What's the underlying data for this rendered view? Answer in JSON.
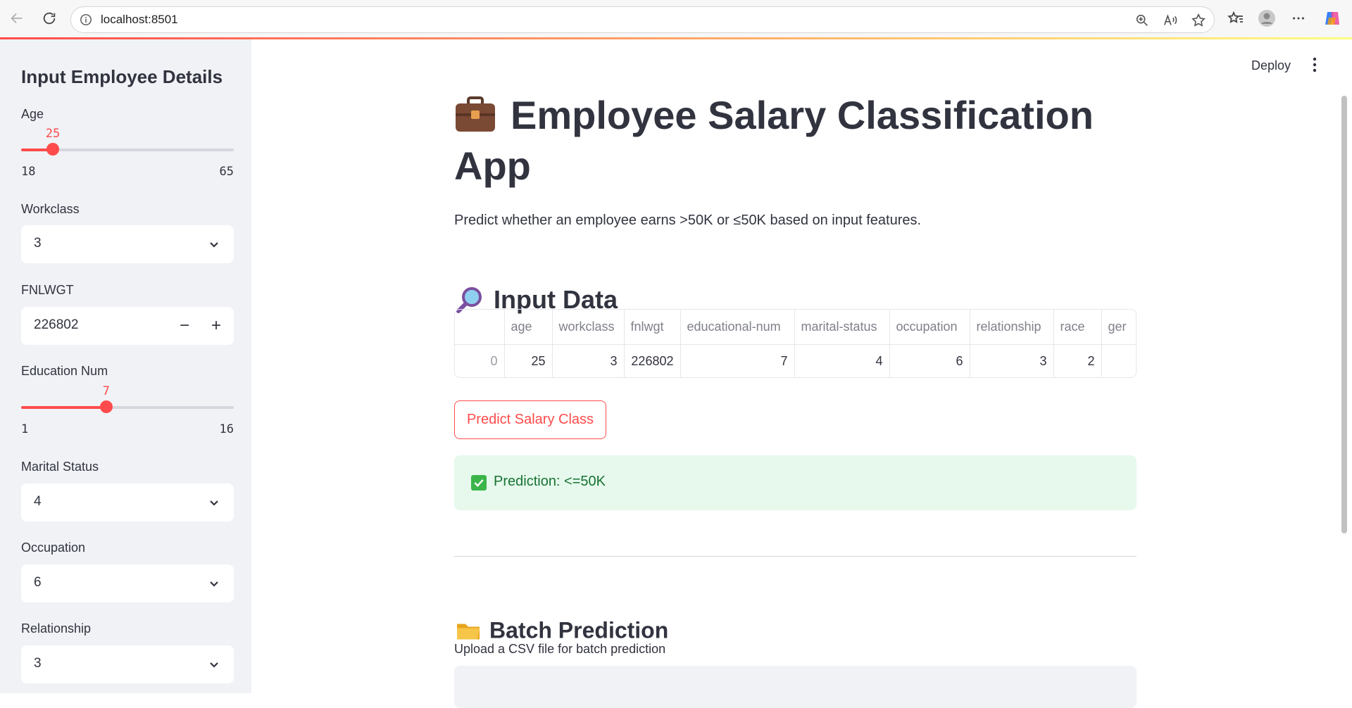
{
  "browser": {
    "url": "localhost:8501"
  },
  "sidebar": {
    "title": "Input Employee Details",
    "age": {
      "label": "Age",
      "value": "25",
      "min": "18",
      "max": "65",
      "fraction": 0.149
    },
    "workclass": {
      "label": "Workclass",
      "value": "3"
    },
    "fnlwgt": {
      "label": "FNLWGT",
      "value": "226802",
      "minus": "−",
      "plus": "+"
    },
    "education_num": {
      "label": "Education Num",
      "value": "7",
      "min": "1",
      "max": "16",
      "fraction": 0.4
    },
    "marital_status": {
      "label": "Marital Status",
      "value": "4"
    },
    "occupation": {
      "label": "Occupation",
      "value": "6"
    },
    "relationship": {
      "label": "Relationship",
      "value": "3"
    }
  },
  "header": {
    "deploy_label": "Deploy"
  },
  "main": {
    "title": "Employee Salary Classification App",
    "subtitle": "Predict whether an employee earns >50K or ≤50K based on input features.",
    "input_heading": "Input Data",
    "table": {
      "columns": [
        "",
        "age",
        "workclass",
        "fnlwgt",
        "educational-num",
        "marital-status",
        "occupation",
        "relationship",
        "race",
        "ger"
      ],
      "rows": [
        [
          "0",
          "25",
          "3",
          "226802",
          "7",
          "4",
          "6",
          "3",
          "2",
          ""
        ]
      ]
    },
    "predict_button": "Predict Salary Class",
    "prediction": "Prediction: <=50K",
    "batch_heading": "Batch Prediction",
    "upload_caption": "Upload a CSV file for batch prediction"
  },
  "colors": {
    "accent": "#ff4b4b",
    "sidebar_bg": "#f0f2f6",
    "success_bg": "#e6f9ec",
    "success_text": "#177233"
  }
}
